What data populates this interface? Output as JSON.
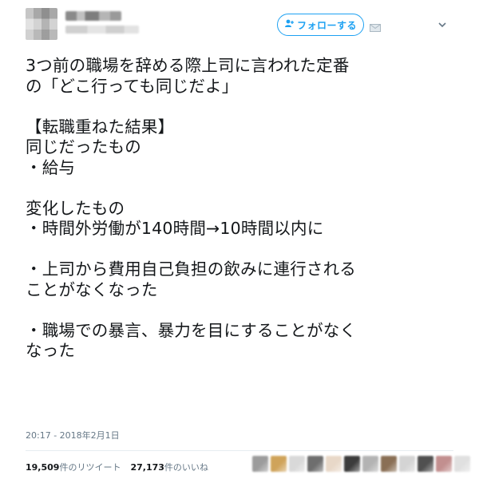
{
  "follow_button": {
    "label": "フォローする"
  },
  "tweet": {
    "lines": [
      "3つ前の職場を辞める際上司に言われた定番",
      "の「どこ行っても同じだよ」",
      "",
      "【転職重ねた結果】",
      "同じだったもの",
      "・給与",
      "",
      "変化したもの",
      "・時間外労働が140時間→10時間以内に",
      "",
      "・上司から費用自己負担の飲みに連行される",
      "ことがなくなった",
      "",
      "・職場での暴言、暴力を目にすることがなく",
      "なった"
    ],
    "timestamp": "20:17 - 2018年2月1日"
  },
  "stats": {
    "retweets_count": "19,509",
    "retweets_label": "件のリツイート",
    "likes_count": "27,173",
    "likes_label": "件のいいね"
  },
  "icons": {
    "follow": "person-add-icon",
    "dm": "envelope-icon",
    "menu": "chevron-down-icon"
  },
  "colors": {
    "accent": "#1da1f2",
    "text": "#14171a",
    "meta": "#657786"
  },
  "likers_swatches": [
    "#9c9c9c",
    "#cfa35a",
    "#d9d9d9",
    "#6e6e6e",
    "#e8d8c8",
    "#3c3c3c",
    "#b3b3b3",
    "#8a6f55",
    "#d4d4d4",
    "#505050",
    "#c28f8f",
    "#e0e0e0"
  ]
}
